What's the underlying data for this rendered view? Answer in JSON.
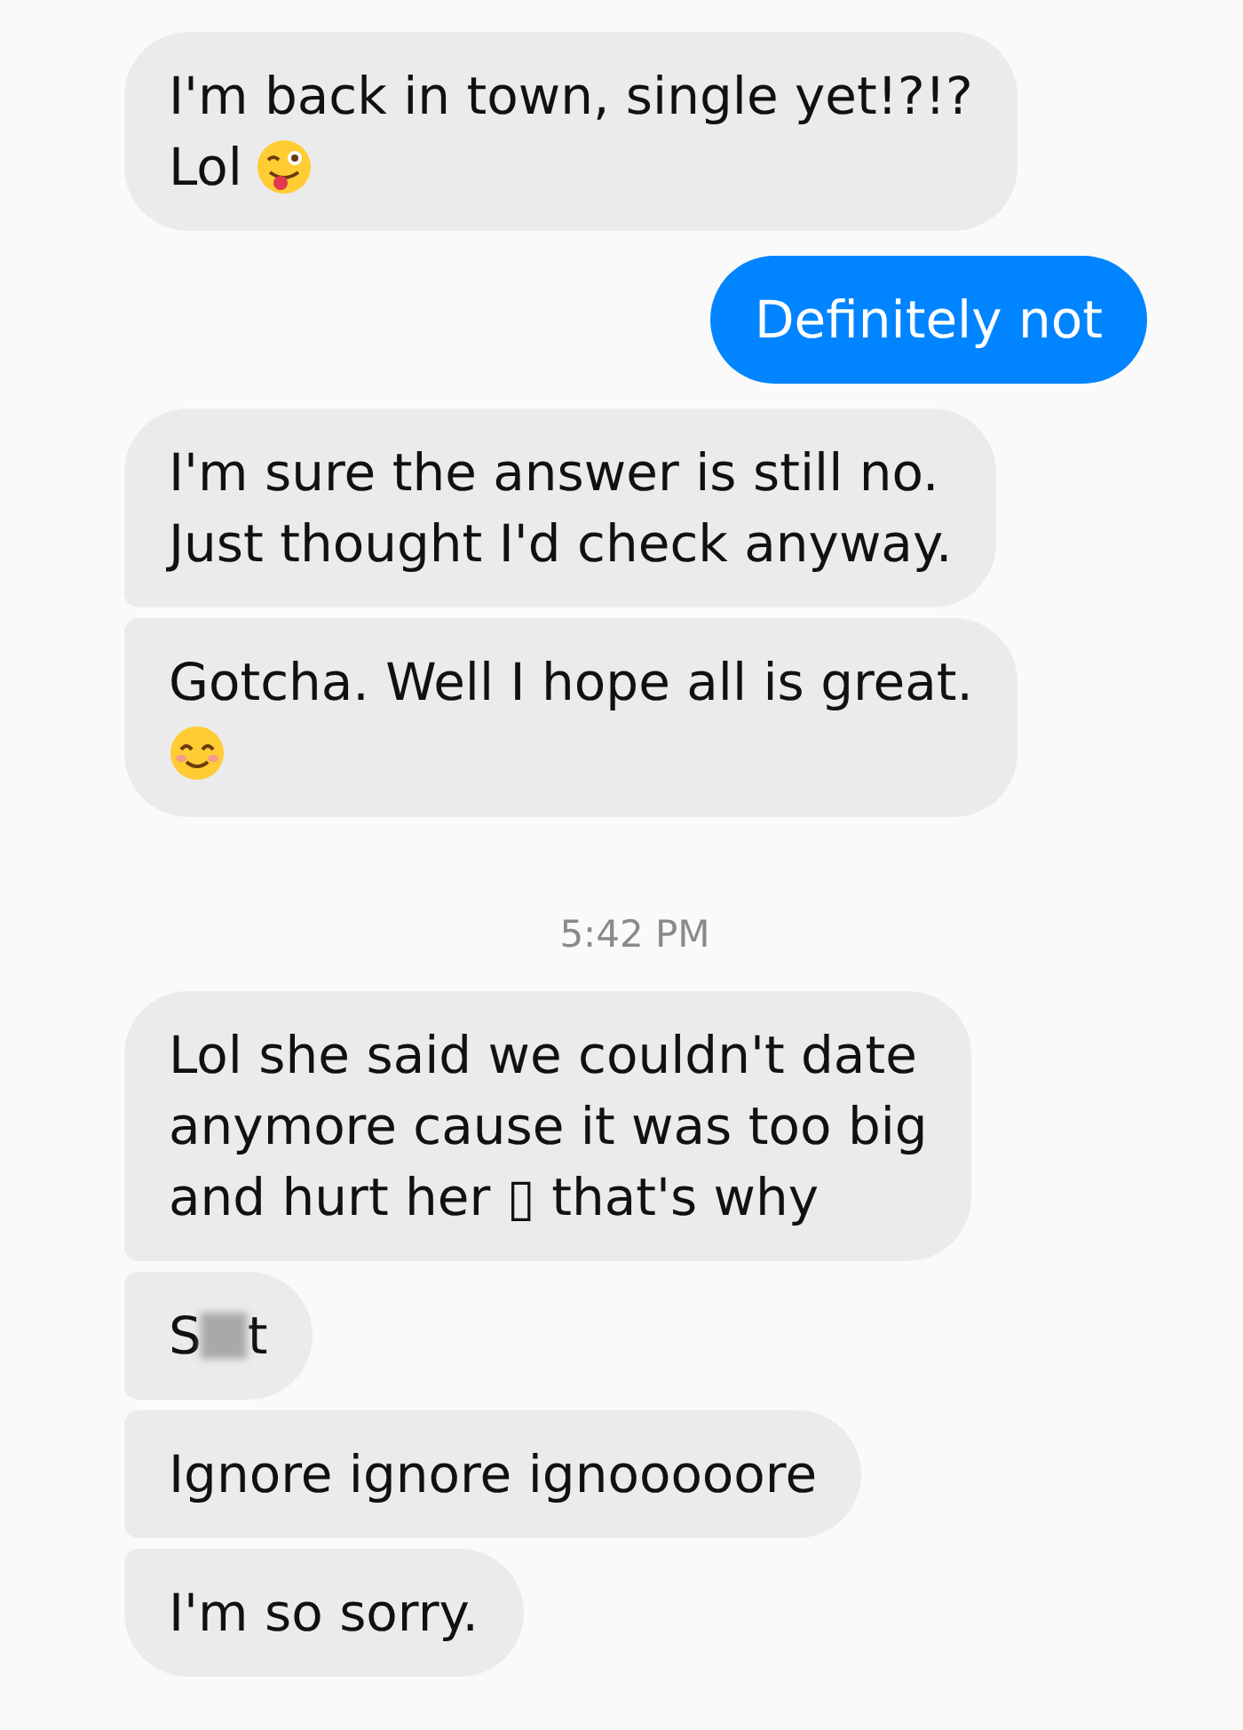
{
  "messages": [
    {
      "kind": "received",
      "lines": [
        [
          {
            "kind": "text",
            "text": "I'm back in town, single yet!?!?"
          }
        ],
        [
          {
            "kind": "text",
            "text": "Lol"
          },
          {
            "kind": "wink_emoji"
          }
        ]
      ]
    },
    {
      "kind": "sent",
      "lines": [
        [
          {
            "kind": "text",
            "text": "Definitely not"
          }
        ]
      ]
    },
    {
      "kind": "received",
      "lines": [
        [
          {
            "kind": "text",
            "text": "I'm sure the answer is still no."
          }
        ],
        [
          {
            "kind": "text",
            "text": "Just thought I'd check anyway."
          }
        ]
      ]
    },
    {
      "kind": "received",
      "lines": [
        [
          {
            "kind": "text",
            "text": "Gotcha. Well I hope all is great."
          }
        ],
        [
          {
            "kind": "smile_emoji"
          }
        ]
      ]
    },
    {
      "kind": "timestamp",
      "text": "5:42 PM"
    },
    {
      "kind": "received",
      "lines": [
        [
          {
            "kind": "text",
            "text": "Lol she said we couldn't date"
          }
        ],
        [
          {
            "kind": "text",
            "text": "anymore cause it was too big"
          }
        ],
        [
          {
            "kind": "text",
            "text": "and hurt her ▯ that's why"
          }
        ]
      ]
    },
    {
      "kind": "received",
      "lines": [
        [
          {
            "kind": "text",
            "text": "S"
          },
          {
            "kind": "censor"
          },
          {
            "kind": "text",
            "text": "t"
          }
        ]
      ]
    },
    {
      "kind": "received",
      "lines": [
        [
          {
            "kind": "text",
            "text": "Ignore ignore ignooooore"
          }
        ]
      ]
    },
    {
      "kind": "received",
      "lines": [
        [
          {
            "kind": "text",
            "text": "I'm so sorry."
          }
        ]
      ]
    }
  ]
}
